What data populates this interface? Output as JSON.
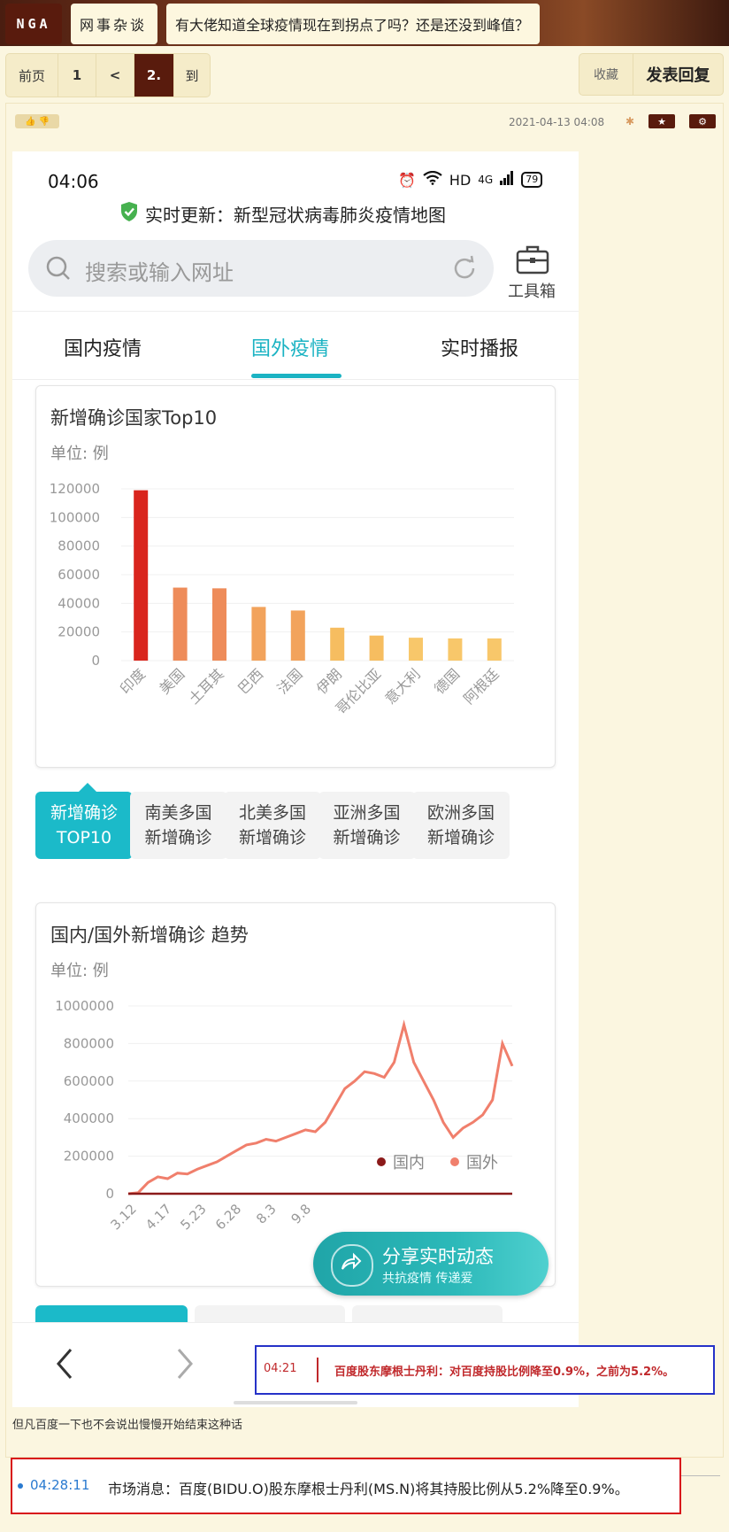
{
  "forum": {
    "logo": "NGA",
    "board": "网事杂谈",
    "thread_title": "有大佬知道全球疫情现在到拐点了吗？还是还没到峰值？"
  },
  "pager": {
    "first": "前页",
    "page1": "1",
    "prev": "<",
    "current": "2.",
    "goto": "到"
  },
  "actions": {
    "favorite": "收藏",
    "reply": "发表回复"
  },
  "post": {
    "date": "2021-04-13 04:08",
    "vote_icons": "👍 👎",
    "device_icon": "android-icon",
    "star_icon": "★",
    "gear_icon": "⚙",
    "comment": "但凡百度一下也不会说出慢慢开始结束这种话"
  },
  "phone": {
    "status_time": "04:06",
    "status_hd": "HD",
    "status_signal": "4G",
    "battery": "79",
    "heading": "实时更新：新型冠状病毒肺炎疫情地图",
    "search_placeholder": "搜索或输入网址",
    "toolbox_label": "工具箱",
    "tabs": [
      "国内疫情",
      "国外疫情",
      "实时播报"
    ],
    "active_tab": 1,
    "accent": "#1bb3c3"
  },
  "card1": {
    "title": "新增确诊国家Top10",
    "unit": "单位: 例"
  },
  "categories": [
    {
      "line1": "新增确诊",
      "line2": "TOP10",
      "active": true
    },
    {
      "line1": "南美多国",
      "line2": "新增确诊",
      "active": false
    },
    {
      "line1": "北美多国",
      "line2": "新增确诊",
      "active": false
    },
    {
      "line1": "亚洲多国",
      "line2": "新增确诊",
      "active": false
    },
    {
      "line1": "欧洲多国",
      "line2": "新增确诊",
      "active": false
    }
  ],
  "card2": {
    "title": "国内/国外新增确诊 趋势",
    "unit": "单位: 例"
  },
  "share": {
    "title": "分享实时动态",
    "subtitle": "共抗疫情 传递爱"
  },
  "news_blue": {
    "time": "04:21",
    "text": "百度股东摩根士丹利：对百度持股比例降至0.9%，之前为5.2%。"
  },
  "news_red": {
    "time": "04:28:11",
    "text": "市场消息：百度(BIDU.O)股东摩根士丹利(MS.N)将其持股比例从5.2%降至0.9%。"
  },
  "chart_data": [
    {
      "type": "bar",
      "title": "新增确诊国家Top10",
      "ylabel": "单位: 例",
      "categories": [
        "印度",
        "美国",
        "土耳其",
        "巴西",
        "法国",
        "伊朗",
        "哥伦比亚",
        "意大利",
        "德国",
        "阿根廷"
      ],
      "values": [
        119000,
        51000,
        50500,
        37500,
        35000,
        23000,
        17500,
        16000,
        15500,
        15500
      ],
      "colors": [
        "#d9251d",
        "#ee8c5a",
        "#ee8c5a",
        "#f2a35c",
        "#f2a35c",
        "#f6bd60",
        "#f6bd60",
        "#f8c76a",
        "#f8c76a",
        "#f8c76a"
      ],
      "yticks": [
        0,
        20000,
        40000,
        60000,
        80000,
        100000,
        120000
      ],
      "ylim": [
        0,
        120000
      ],
      "grid": true
    },
    {
      "type": "line",
      "title": "国内/国外新增确诊 趋势",
      "ylabel": "单位: 例",
      "x_ticks": [
        "3.12",
        "4.17",
        "5.23",
        "6.28",
        "8.3",
        "9.8"
      ],
      "yticks": [
        0,
        200000,
        400000,
        600000,
        800000,
        1000000
      ],
      "ylim": [
        0,
        1000000
      ],
      "legend": "top-right",
      "series": [
        {
          "name": "国内",
          "color": "#8b1a1a",
          "values": [
            0,
            0,
            0,
            0,
            0,
            0,
            0,
            0,
            0,
            0,
            0,
            0,
            0,
            0,
            0,
            0,
            0,
            0,
            0,
            0,
            0,
            0,
            0,
            0,
            0,
            0,
            0,
            0,
            0,
            0,
            0,
            0,
            0,
            0,
            0,
            0,
            0,
            0,
            0,
            0
          ]
        },
        {
          "name": "国外",
          "color": "#f07f6c",
          "values": [
            0,
            5000,
            60000,
            90000,
            80000,
            110000,
            105000,
            130000,
            150000,
            170000,
            200000,
            230000,
            260000,
            270000,
            290000,
            280000,
            300000,
            320000,
            340000,
            330000,
            380000,
            470000,
            560000,
            600000,
            650000,
            640000,
            620000,
            700000,
            900000,
            700000,
            600000,
            500000,
            380000,
            300000,
            350000,
            380000,
            420000,
            500000,
            800000,
            680000
          ]
        }
      ]
    }
  ]
}
